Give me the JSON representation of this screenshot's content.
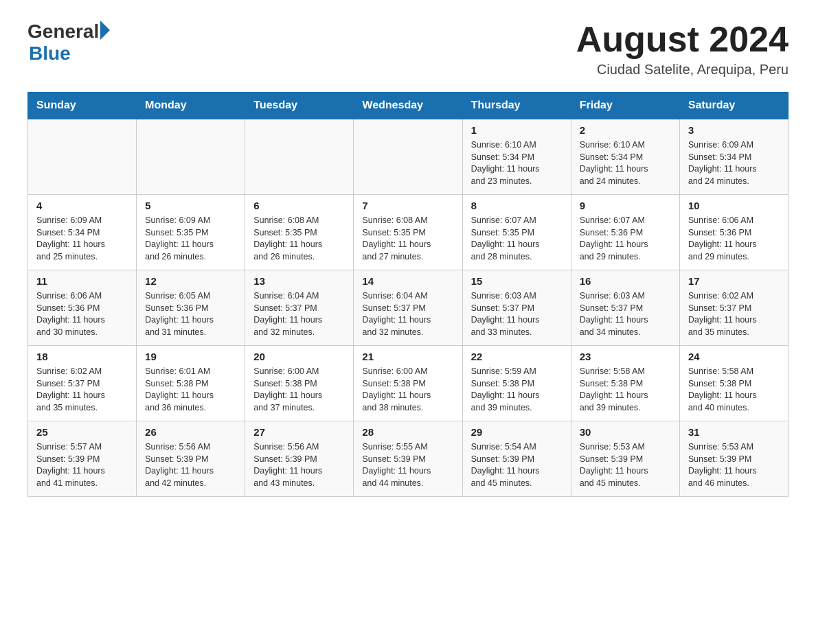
{
  "header": {
    "logo_general": "General",
    "logo_blue": "Blue",
    "title": "August 2024",
    "subtitle": "Ciudad Satelite, Arequipa, Peru"
  },
  "weekdays": [
    "Sunday",
    "Monday",
    "Tuesday",
    "Wednesday",
    "Thursday",
    "Friday",
    "Saturday"
  ],
  "weeks": [
    [
      {
        "day": "",
        "info": ""
      },
      {
        "day": "",
        "info": ""
      },
      {
        "day": "",
        "info": ""
      },
      {
        "day": "",
        "info": ""
      },
      {
        "day": "1",
        "info": "Sunrise: 6:10 AM\nSunset: 5:34 PM\nDaylight: 11 hours\nand 23 minutes."
      },
      {
        "day": "2",
        "info": "Sunrise: 6:10 AM\nSunset: 5:34 PM\nDaylight: 11 hours\nand 24 minutes."
      },
      {
        "day": "3",
        "info": "Sunrise: 6:09 AM\nSunset: 5:34 PM\nDaylight: 11 hours\nand 24 minutes."
      }
    ],
    [
      {
        "day": "4",
        "info": "Sunrise: 6:09 AM\nSunset: 5:34 PM\nDaylight: 11 hours\nand 25 minutes."
      },
      {
        "day": "5",
        "info": "Sunrise: 6:09 AM\nSunset: 5:35 PM\nDaylight: 11 hours\nand 26 minutes."
      },
      {
        "day": "6",
        "info": "Sunrise: 6:08 AM\nSunset: 5:35 PM\nDaylight: 11 hours\nand 26 minutes."
      },
      {
        "day": "7",
        "info": "Sunrise: 6:08 AM\nSunset: 5:35 PM\nDaylight: 11 hours\nand 27 minutes."
      },
      {
        "day": "8",
        "info": "Sunrise: 6:07 AM\nSunset: 5:35 PM\nDaylight: 11 hours\nand 28 minutes."
      },
      {
        "day": "9",
        "info": "Sunrise: 6:07 AM\nSunset: 5:36 PM\nDaylight: 11 hours\nand 29 minutes."
      },
      {
        "day": "10",
        "info": "Sunrise: 6:06 AM\nSunset: 5:36 PM\nDaylight: 11 hours\nand 29 minutes."
      }
    ],
    [
      {
        "day": "11",
        "info": "Sunrise: 6:06 AM\nSunset: 5:36 PM\nDaylight: 11 hours\nand 30 minutes."
      },
      {
        "day": "12",
        "info": "Sunrise: 6:05 AM\nSunset: 5:36 PM\nDaylight: 11 hours\nand 31 minutes."
      },
      {
        "day": "13",
        "info": "Sunrise: 6:04 AM\nSunset: 5:37 PM\nDaylight: 11 hours\nand 32 minutes."
      },
      {
        "day": "14",
        "info": "Sunrise: 6:04 AM\nSunset: 5:37 PM\nDaylight: 11 hours\nand 32 minutes."
      },
      {
        "day": "15",
        "info": "Sunrise: 6:03 AM\nSunset: 5:37 PM\nDaylight: 11 hours\nand 33 minutes."
      },
      {
        "day": "16",
        "info": "Sunrise: 6:03 AM\nSunset: 5:37 PM\nDaylight: 11 hours\nand 34 minutes."
      },
      {
        "day": "17",
        "info": "Sunrise: 6:02 AM\nSunset: 5:37 PM\nDaylight: 11 hours\nand 35 minutes."
      }
    ],
    [
      {
        "day": "18",
        "info": "Sunrise: 6:02 AM\nSunset: 5:37 PM\nDaylight: 11 hours\nand 35 minutes."
      },
      {
        "day": "19",
        "info": "Sunrise: 6:01 AM\nSunset: 5:38 PM\nDaylight: 11 hours\nand 36 minutes."
      },
      {
        "day": "20",
        "info": "Sunrise: 6:00 AM\nSunset: 5:38 PM\nDaylight: 11 hours\nand 37 minutes."
      },
      {
        "day": "21",
        "info": "Sunrise: 6:00 AM\nSunset: 5:38 PM\nDaylight: 11 hours\nand 38 minutes."
      },
      {
        "day": "22",
        "info": "Sunrise: 5:59 AM\nSunset: 5:38 PM\nDaylight: 11 hours\nand 39 minutes."
      },
      {
        "day": "23",
        "info": "Sunrise: 5:58 AM\nSunset: 5:38 PM\nDaylight: 11 hours\nand 39 minutes."
      },
      {
        "day": "24",
        "info": "Sunrise: 5:58 AM\nSunset: 5:38 PM\nDaylight: 11 hours\nand 40 minutes."
      }
    ],
    [
      {
        "day": "25",
        "info": "Sunrise: 5:57 AM\nSunset: 5:39 PM\nDaylight: 11 hours\nand 41 minutes."
      },
      {
        "day": "26",
        "info": "Sunrise: 5:56 AM\nSunset: 5:39 PM\nDaylight: 11 hours\nand 42 minutes."
      },
      {
        "day": "27",
        "info": "Sunrise: 5:56 AM\nSunset: 5:39 PM\nDaylight: 11 hours\nand 43 minutes."
      },
      {
        "day": "28",
        "info": "Sunrise: 5:55 AM\nSunset: 5:39 PM\nDaylight: 11 hours\nand 44 minutes."
      },
      {
        "day": "29",
        "info": "Sunrise: 5:54 AM\nSunset: 5:39 PM\nDaylight: 11 hours\nand 45 minutes."
      },
      {
        "day": "30",
        "info": "Sunrise: 5:53 AM\nSunset: 5:39 PM\nDaylight: 11 hours\nand 45 minutes."
      },
      {
        "day": "31",
        "info": "Sunrise: 5:53 AM\nSunset: 5:39 PM\nDaylight: 11 hours\nand 46 minutes."
      }
    ]
  ]
}
